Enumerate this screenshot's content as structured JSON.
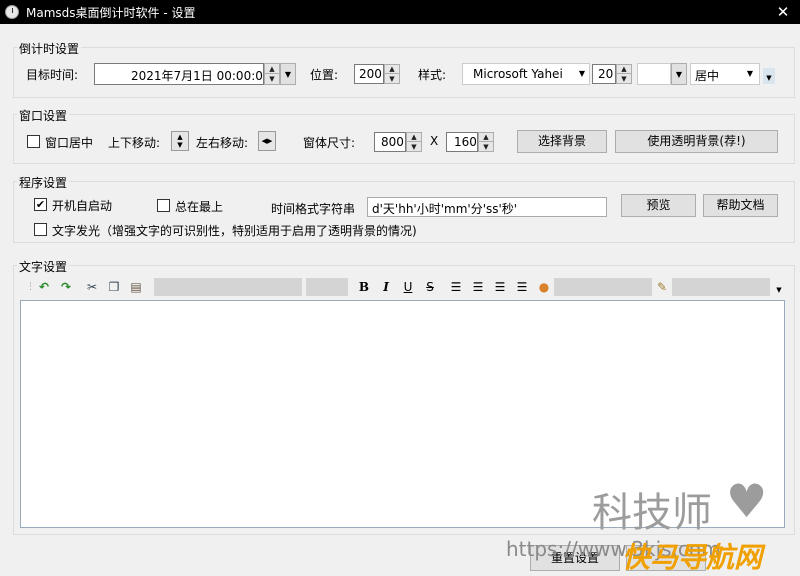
{
  "window": {
    "title": "Mamsds桌面倒计时软件 - 设置",
    "close": "✕"
  },
  "countdown": {
    "legend": "倒计时设置",
    "target_label": "目标时间:",
    "target_value": "2021年7月1日 00:00:00",
    "position_label": "位置:",
    "position_value": "200",
    "style_label": "样式:",
    "font_value": "Microsoft Yahei",
    "size_value": "20",
    "align_value": "居中"
  },
  "window_settings": {
    "legend": "窗口设置",
    "center_label": "窗口居中",
    "updown_label": "上下移动:",
    "leftright_label": "左右移动:",
    "size_label": "窗体尺寸:",
    "width_value": "800",
    "x_label": "X",
    "height_value": "160",
    "bg_button": "选择背景",
    "transparent_button": "使用透明背景(荐!)"
  },
  "program": {
    "legend": "程序设置",
    "autostart_label": "开机自启动",
    "autostart_checked": "✔",
    "topmost_label": "总在最上",
    "format_label": "时间格式字符串",
    "format_value": "d'天'hh'小时'mm'分'ss'秒'",
    "preview_button": "预览",
    "help_button": "帮助文档",
    "glow_label": "文字发光（增强文字的可识别性，特别适用于启用了透明背景的情况)"
  },
  "text_settings": {
    "legend": "文字设置"
  },
  "footer": {
    "reset_button": "重置设置"
  },
  "watermarks": {
    "brand_text": "科技师",
    "url": "https://www.3kjs.com",
    "site": "快马导航网"
  },
  "colors": {
    "titlebar": "#000000",
    "background": "#f0f0f0",
    "watermark_orange": "#f0a000"
  }
}
